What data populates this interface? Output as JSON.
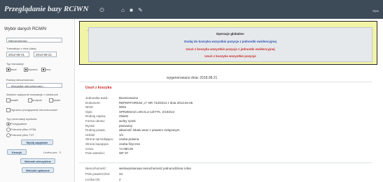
{
  "app": {
    "title": "Przeglądanie bazy RCiWN",
    "user": "Wylo"
  },
  "left": {
    "header": "Wybór danych RCiWN",
    "db_select": "Nieruchomości",
    "date_label": "Transakcje z dnia (data)",
    "date_from": "2012-08-21",
    "date_to": "2013-08-21",
    "type_label": "Typ transakcji",
    "types": [
      "dane",
      "wycena",
      "inny"
    ],
    "prop_label": "Rodzaj nieruchomości",
    "prop_select": "-- Wszystkie nieruchomości --",
    "limit_label": "Wybierz wyłącznie transakcje o strukturze",
    "limits": [
      "działki",
      "budynki",
      "lokale"
    ],
    "only_label": "Ogranicz przeglądanie nieruchomości",
    "fmt_label": "Typ prezentacji wyników:",
    "fmts": [
      "Przeglądanie",
      "Pobranie pliku HTML",
      "Pobranie pliku TXT"
    ],
    "btn_search": "Wyślij zapytanie",
    "btn_cart": "Koszyk",
    "cart_count": "Liczba poz.: 3",
    "btn_print": "Wnioski wierzytelne",
    "btn_paid": "Wnioski opłacone"
  },
  "ops": {
    "title": "Operacje globalne:",
    "line1": "Dodaj do koszyka wszystkie pozycje z jednostki ewidencyjnej",
    "line2": "Usuń z koszyka wszystkie pozycje z jednostki ewidencyjnej",
    "line3": "Usuń z koszyka wszystkie pozycje",
    "colors": {
      "line1": "#2a4fb0",
      "line2": "#cc2b2b",
      "line3": "#cc2b2b"
    }
  },
  "main": {
    "generated": "wygenerowano dnia: 2018.08.21",
    "section": "Usuń z koszyka",
    "rows": [
      {
        "k": "Jednostka ewid.:",
        "v": "Biomiszewice"
      },
      {
        "k": "Dokument:",
        "v": "REPERTORIUM „A” NR 734/2013 z dnia 2013.02.05"
      },
      {
        "k": "NKW:",
        "v": "0003"
      },
      {
        "k": "Opis:",
        "v": "SPRZEDAŻ LOKALU UŻYTK. 2/103/13"
      },
      {
        "k": "Rodzaj zapisu:",
        "v": "Obiekt"
      },
      {
        "k": "Forma obrotu:",
        "v": "wolny rynek"
      },
      {
        "k": "Rynek:",
        "v": "pierwotny"
      },
      {
        "k": "Rodzaj prawa:",
        "v": "własność lokalu wraz z prawem związanym"
      },
      {
        "k": "Udział:",
        "v": "1/1"
      },
      {
        "k": "Strona sprzedająca:",
        "v": "osoba prawna"
      },
      {
        "k": "Strona kupująca:",
        "v": "osoba fizyczna"
      },
      {
        "k": "Cena:",
        "v": "74 090,00"
      },
      {
        "k": "Pole wartości:",
        "v": "WF 97"
      }
    ],
    "rows2": [
      {
        "k": "Nieruchomość:",
        "v": "wielowymiarowa nieruchomość jednorodzinna rolna"
      },
      {
        "k": "Pole powierzchni:",
        "v": "34"
      },
      {
        "k": "Liczba izb:",
        "v": "2"
      }
    ]
  }
}
